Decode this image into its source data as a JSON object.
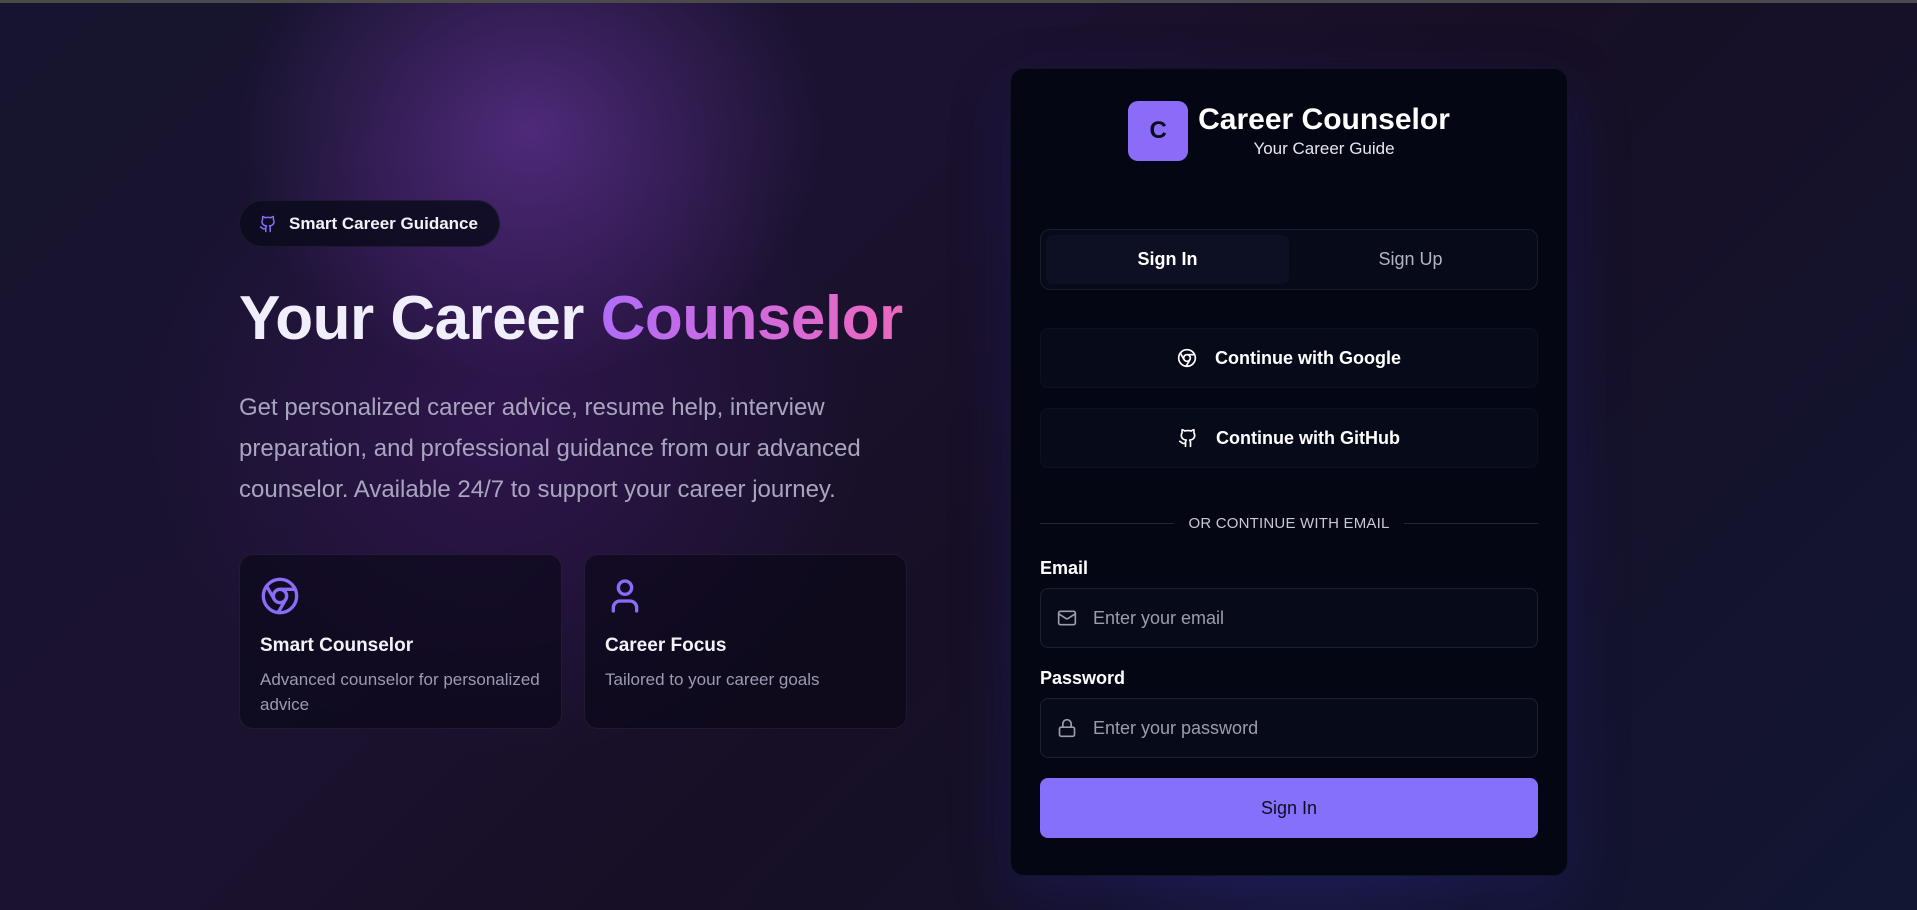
{
  "hero": {
    "badge_label": "Smart Career Guidance",
    "title_part1": "Your Career ",
    "title_part2": "Counselor",
    "description": "Get personalized career advice, resume help, interview preparation, and professional guidance from our advanced counselor. Available 24/7 to support your career journey.",
    "features": [
      {
        "icon": "chrome-icon",
        "title": "Smart Counselor",
        "description": "Advanced counselor for personalized advice"
      },
      {
        "icon": "user-icon",
        "title": "Career Focus",
        "description": "Tailored to your career goals"
      }
    ]
  },
  "auth_card": {
    "logo_letter": "C",
    "brand_name": "Career Counselor",
    "brand_subtitle": "Your Career Guide",
    "tabs": [
      {
        "label": "Sign In",
        "active": true
      },
      {
        "label": "Sign Up",
        "active": false
      }
    ],
    "google_button": "Continue with Google",
    "github_button": "Continue with GitHub",
    "divider_text": "OR CONTINUE WITH EMAIL",
    "email": {
      "label": "Email",
      "placeholder": "Enter your email",
      "value": ""
    },
    "password": {
      "label": "Password",
      "placeholder": "Enter your password",
      "value": ""
    },
    "submit_label": "Sign In"
  },
  "colors": {
    "accent": "#8570fb",
    "logo_bg": "#8a6cf8",
    "title_gradient_start": "#b06cf7",
    "title_gradient_end": "#ec67bc",
    "icon_purple": "#8b6cf6"
  }
}
